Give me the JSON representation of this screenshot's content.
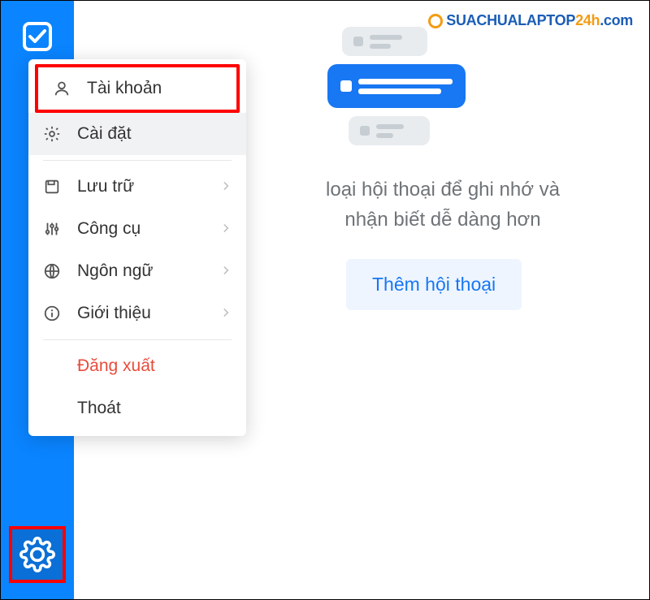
{
  "watermark": {
    "part1": "SUACHUALAPTOP",
    "part2": "24h",
    "part3": ".com"
  },
  "menu": {
    "account": {
      "label": "Tài khoản"
    },
    "settings": {
      "label": "Cài đặt"
    },
    "storage": {
      "label": "Lưu trữ"
    },
    "tools": {
      "label": "Công cụ"
    },
    "language": {
      "label": "Ngôn ngữ"
    },
    "about": {
      "label": "Giới thiệu"
    },
    "logout": {
      "label": "Đăng xuất"
    },
    "exit": {
      "label": "Thoát"
    }
  },
  "main": {
    "hint_line1": "loại hội thoại để ghi nhớ và",
    "hint_line2": "nhận biết dễ dàng hơn",
    "add_button": "Thêm hội thoại"
  }
}
